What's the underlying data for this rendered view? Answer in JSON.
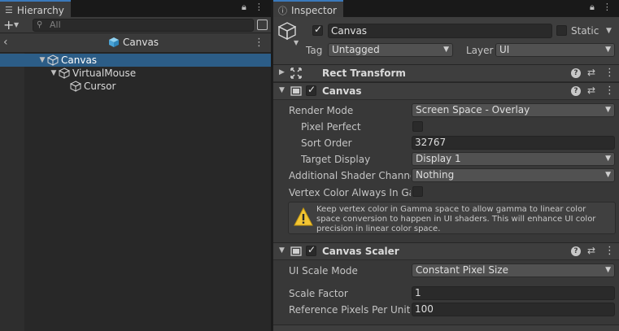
{
  "hierarchy": {
    "tab_label": "Hierarchy",
    "search_placeholder": "All",
    "header_title": "Canvas",
    "tree": [
      {
        "label": "Canvas",
        "depth": 0,
        "expanded": true,
        "selected": true
      },
      {
        "label": "VirtualMouse",
        "depth": 1,
        "expanded": true,
        "selected": false
      },
      {
        "label": "Cursor",
        "depth": 2,
        "expanded": false,
        "selected": false
      }
    ]
  },
  "inspector": {
    "tab_label": "Inspector",
    "object": {
      "active": true,
      "name": "Canvas",
      "static_label": "Static",
      "tag_label": "Tag",
      "tag_value": "Untagged",
      "layer_label": "Layer",
      "layer_value": "UI"
    },
    "rect_transform": {
      "title": "Rect Transform"
    },
    "canvas": {
      "title": "Canvas",
      "enabled": true,
      "render_mode_label": "Render Mode",
      "render_mode_value": "Screen Space - Overlay",
      "pixel_perfect_label": "Pixel Perfect",
      "pixel_perfect": false,
      "sort_order_label": "Sort Order",
      "sort_order_value": "32767",
      "target_display_label": "Target Display",
      "target_display_value": "Display 1",
      "shader_channel_label": "Additional Shader Channel",
      "shader_channel_value": "Nothing",
      "vertex_color_label": "Vertex Color Always In Gar",
      "vertex_color": false,
      "warning": "Keep vertex color in Gamma space to allow gamma to linear color space conversion to happen in UI shaders. This will enhance UI color precision in linear color space."
    },
    "canvas_scaler": {
      "title": "Canvas Scaler",
      "enabled": true,
      "ui_scale_mode_label": "UI Scale Mode",
      "ui_scale_mode_value": "Constant Pixel Size",
      "scale_factor_label": "Scale Factor",
      "scale_factor_value": "1",
      "ref_ppu_label": "Reference Pixels Per Unit",
      "ref_ppu_value": "100"
    }
  },
  "colors": {
    "selection": "#2c5d87",
    "tab_accent": "#3a79bb",
    "cube_blue": "#5cb6e6"
  }
}
